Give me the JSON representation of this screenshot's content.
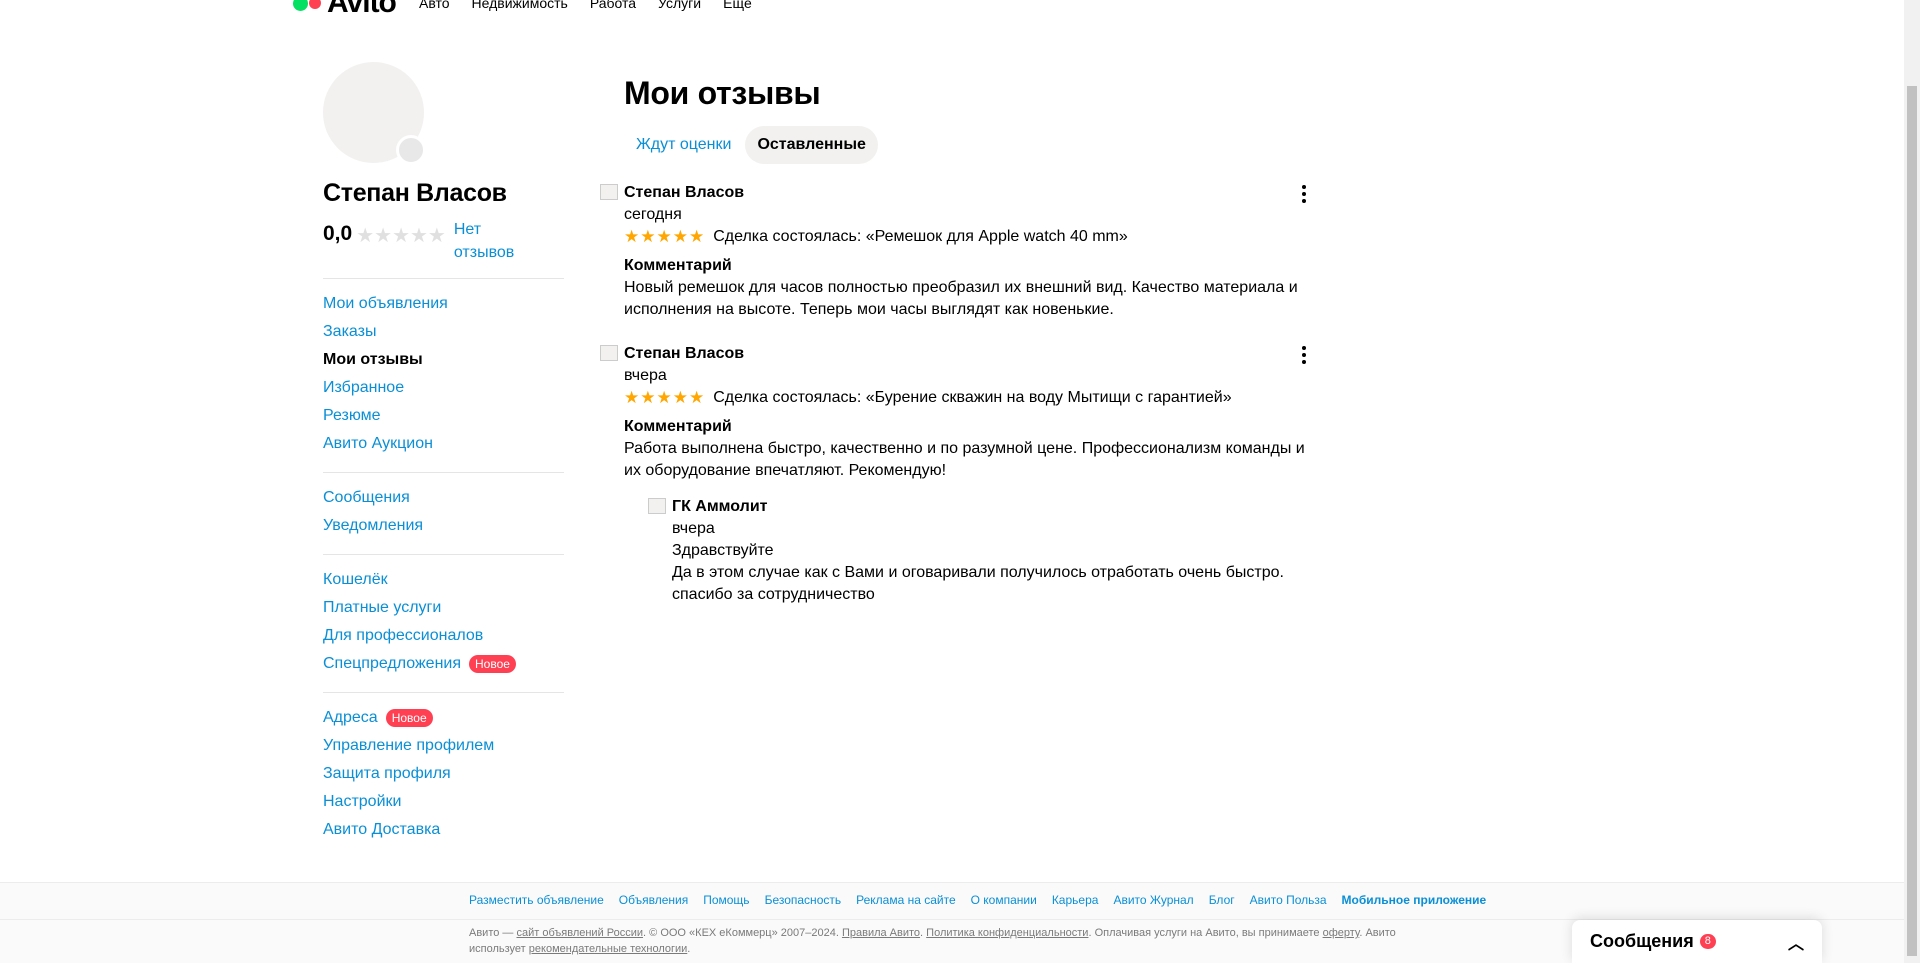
{
  "header": {
    "logo_text": "Avito",
    "nav": [
      "Авто",
      "Недвижимость",
      "Работа",
      "Услуги",
      "Ещё"
    ]
  },
  "sidebar": {
    "user_name": "Степан Власов",
    "rating": "0,0",
    "no_reviews": "Нет отзывов",
    "groups": [
      [
        {
          "label": "Мои объявления"
        },
        {
          "label": "Заказы"
        },
        {
          "label": "Мои отзывы",
          "active": true
        },
        {
          "label": "Избранное"
        },
        {
          "label": "Резюме"
        },
        {
          "label": "Авито Аукцион"
        }
      ],
      [
        {
          "label": "Сообщения"
        },
        {
          "label": "Уведомления"
        }
      ],
      [
        {
          "label": "Кошелёк"
        },
        {
          "label": "Платные услуги"
        },
        {
          "label": "Для профессионалов"
        },
        {
          "label": "Спецпредложения",
          "badge": "Новое"
        }
      ],
      [
        {
          "label": "Адреса",
          "badge": "Новое"
        },
        {
          "label": "Управление профилем"
        },
        {
          "label": "Защита профиля"
        },
        {
          "label": "Настройки"
        },
        {
          "label": "Авито Доставка"
        }
      ]
    ]
  },
  "main": {
    "title": "Мои отзывы",
    "tabs": [
      {
        "label": "Ждут оценки",
        "active": false
      },
      {
        "label": "Оставленные",
        "active": true
      }
    ],
    "reviews": [
      {
        "author": "Степан Власов",
        "date": "сегодня",
        "stars": "★★★★★",
        "deal": "Сделка состоялась: «Ремешок для Apple watch 40 mm»",
        "comment_heading": "Комментарий",
        "comment": "Новый ремешок для часов полностью преобразил их внешний вид. Качество материала и исполнения на высоте. Теперь мои часы выглядят как новенькие."
      },
      {
        "author": "Степан Власов",
        "date": "вчера",
        "stars": "★★★★★",
        "deal": "Сделка состоялась: «Бурение скважин на воду Мытищи с гарантией»",
        "comment_heading": "Комментарий",
        "comment": "Работа выполнена быстро, качественно и по разумной цене. Профессионализм команды и их оборудование впечатляют. Рекомендую!",
        "reply": {
          "author": "ГК Аммолит",
          "date": "вчера",
          "greeting": "Здравствуйте",
          "text": "Да в этом случае как с Вами и оговаривали получилось отработать очень быстро. спасибо за сотрудничество"
        }
      }
    ]
  },
  "footer": {
    "links": [
      "Разместить объявление",
      "Объявления",
      "Помощь",
      "Безопасность",
      "Реклама на сайте",
      "О компании",
      "Карьера",
      "Авито Журнал",
      "Блог",
      "Авито Польза",
      "Мобильное приложение"
    ],
    "legal_prefix": "Авито — ",
    "legal_link1": "сайт объявлений России",
    "legal_mid1": ". © ООО «КЕХ eКоммерц» 2007–2024. ",
    "legal_link2": "Правила Авито",
    "legal_mid2": ". ",
    "legal_link3": "Политика конфиденциальности",
    "legal_mid3": ". Оплачивая услуги на Авито, вы принимаете ",
    "legal_link4": "оферту",
    "legal_mid4": ". Авито использует ",
    "legal_link5": "рекомендательные технологии",
    "legal_end": "."
  },
  "messages_widget": {
    "label": "Сообщения",
    "count": "8"
  },
  "colors": {
    "link": "#0a8fd6",
    "star": "#ffa600",
    "badge": "#ff4053",
    "logo_green": "#04e061"
  }
}
